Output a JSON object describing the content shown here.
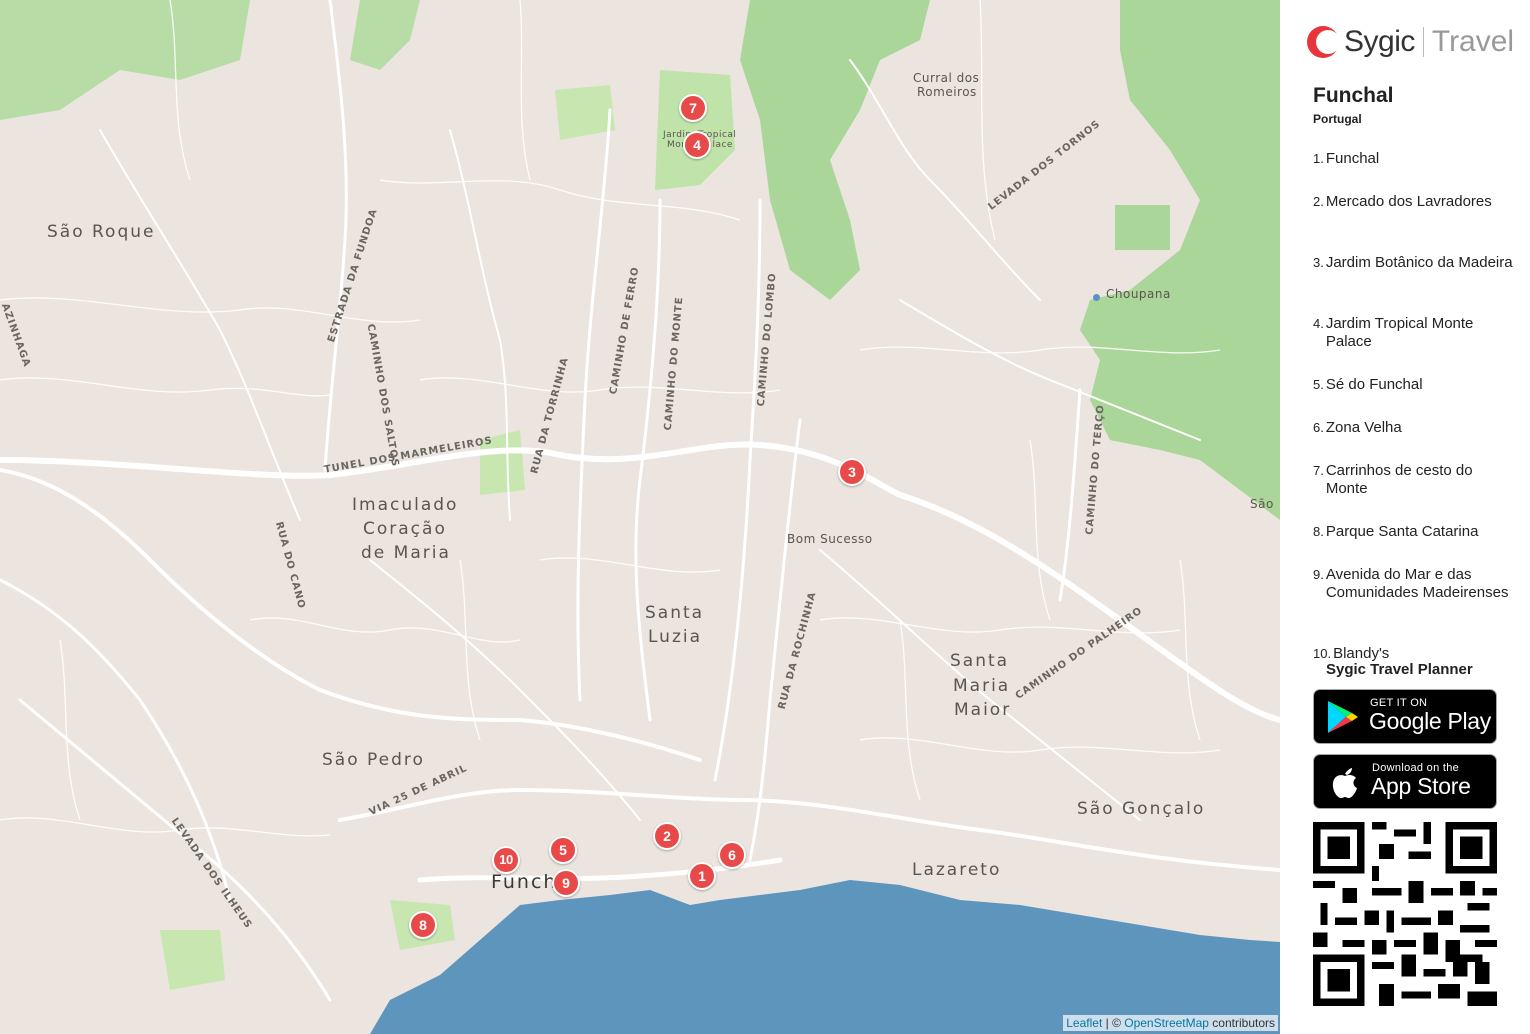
{
  "header": {
    "brand": "Sygic",
    "product": "Travel"
  },
  "sidebar": {
    "city": "Funchal",
    "country": "Portugal",
    "places": [
      {
        "num": "1.",
        "name": "Funchal"
      },
      {
        "num": "2.",
        "name": "Mercado dos Lavradores"
      },
      {
        "num": "3.",
        "name": "Jardim Botânico da Madeira"
      },
      {
        "num": "4.",
        "name": "Jardim Tropical Monte Palace"
      },
      {
        "num": "5.",
        "name": "Sé do Funchal"
      },
      {
        "num": "6.",
        "name": "Zona Velha"
      },
      {
        "num": "7.",
        "name": "Carrinhos de cesto do Monte"
      },
      {
        "num": "8.",
        "name": "Parque Santa Catarina"
      },
      {
        "num": "9.",
        "name": "Avenida do Mar e das Comunidades Madeirenses"
      },
      {
        "num": "10.",
        "name": "Blandy's"
      }
    ],
    "planner_label": "Sygic Travel Planner",
    "google_play": {
      "small": "GET IT ON",
      "big": "Google Play"
    },
    "app_store": {
      "small": "Download on the",
      "big": "App Store"
    },
    "qr_icon": "qr-code-icon"
  },
  "map": {
    "labels": {
      "sao_roque": "São Roque",
      "imaculado": "Imaculado",
      "coracao": "Coração",
      "de_maria": "de Maria",
      "santa": "Santa",
      "luzia": "Luzia",
      "sao_pedro": "São Pedro",
      "funchal": "Funchal",
      "santa2": "Santa",
      "maria": "Maria",
      "maior": "Maior",
      "sao_goncalo": "São Gonçalo",
      "lazareto": "Lazareto",
      "bom_sucesso": "Bom Sucesso",
      "choupana": "Choupana",
      "curral1": "Curral dos",
      "curral2": "Romeiros",
      "sao_edge": "São",
      "jardim_tropical": "Jardim Tropical",
      "monte_palace": "Monte Palace"
    },
    "streets": {
      "fundoa": "ESTRADA DA FUNDOA",
      "saltos": "CAMINHO DOS SALTOS",
      "tunel": "TUNEL DOS MARMELEIROS",
      "torrinha": "RUA DA TORRINHA",
      "ferro": "CAMINHO DE FERRO",
      "monte": "CAMINHO DO MONTE",
      "lombo": "CAMINHO DO LOMBO",
      "tornos": "LEVADA DOS TORNOS",
      "terco": "CAMINHO DO TERÇO",
      "palheiro": "CAMINHO DO PALHEIRO",
      "rochinha": "RUA DA ROCHINHA",
      "cano": "RUA DO CANO",
      "via25": "VIA 25 DE ABRIL",
      "ilheus": "LEVADA DOS ILHEUS",
      "azinhaga": "AZINHAGA"
    },
    "markers": [
      "1",
      "2",
      "3",
      "4",
      "5",
      "6",
      "7",
      "8",
      "9",
      "10"
    ],
    "attribution": {
      "leaflet": "Leaflet",
      "sep": " | © ",
      "osm": "OpenStreetMap",
      "contrib": " contributors"
    }
  },
  "colors": {
    "land": "#ebe4df",
    "park": "#c8e6b0",
    "forest": "#abd69a",
    "water": "#5d95bd",
    "road": "#ffffff",
    "marker": "#e84a4a",
    "brand_red": "#e8343b"
  }
}
